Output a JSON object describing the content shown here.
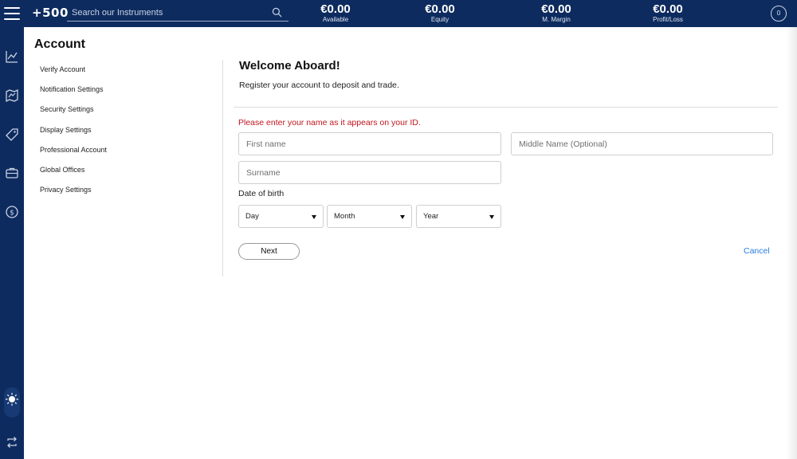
{
  "header": {
    "logo": "+500",
    "search_placeholder": "Search our Instruments",
    "stats": [
      {
        "value": "€0.00",
        "label": "Available"
      },
      {
        "value": "€0.00",
        "label": "Equity"
      },
      {
        "value": "€0.00",
        "label": "M. Margin"
      },
      {
        "value": "€0.00",
        "label": "Profit/Loss"
      }
    ],
    "notification_count": "0"
  },
  "rail": {
    "icons": [
      "menu-icon",
      "chart-icon",
      "map-icon",
      "tag-icon",
      "briefcase-icon",
      "dollar-circle-icon",
      "sun-icon",
      "swap-icon"
    ]
  },
  "account": {
    "title": "Account",
    "menu": [
      "Verify Account",
      "Notification Settings",
      "Security Settings",
      "Display Settings",
      "Professional Account",
      "Global Offices",
      "Privacy Settings"
    ]
  },
  "form": {
    "heading": "Welcome Aboard!",
    "subtitle": "Register your account to deposit and trade.",
    "warning": "Please enter your name as it appears on your ID.",
    "warning_color": "#c0161e",
    "first_name_placeholder": "First name",
    "middle_name_placeholder": "Middle Name (Optional)",
    "surname_placeholder": "Surname",
    "dob_label": "Date of birth",
    "day_label": "Day",
    "month_label": "Month",
    "year_label": "Year",
    "next_label": "Next",
    "cancel_label": "Cancel",
    "cancel_color": "#2a7de1"
  },
  "colors": {
    "brand_navy": "#0d2b5e"
  }
}
